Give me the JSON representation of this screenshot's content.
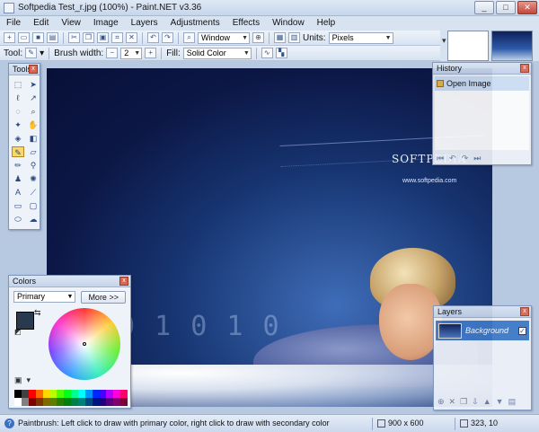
{
  "window": {
    "title": "Softpedia Test_r.jpg (100%) - Paint.NET v3.36",
    "buttons": {
      "minimize": "_",
      "maximize": "□",
      "close": "✕"
    }
  },
  "menu": [
    "File",
    "Edit",
    "View",
    "Image",
    "Layers",
    "Adjustments",
    "Effects",
    "Window",
    "Help"
  ],
  "toolbar": {
    "zoom_mode": "Window",
    "units_label": "Units:",
    "units_value": "Pixels"
  },
  "toolbar2": {
    "tool_label": "Tool:",
    "brush_width_label": "Brush width:",
    "brush_width_value": "2",
    "fill_label": "Fill:",
    "fill_value": "Solid Color"
  },
  "canvas": {
    "watermark": "SOFTPEDIA",
    "watermark_url": "www.softpedia.com"
  },
  "panels": {
    "tools": {
      "title": "Tools"
    },
    "history": {
      "title": "History",
      "items": [
        "Open Image"
      ]
    },
    "colors": {
      "title": "Colors",
      "mode": "Primary",
      "more_button": "More >>"
    },
    "layers": {
      "title": "Layers",
      "items": [
        {
          "name": "Background",
          "visible": true
        }
      ]
    }
  },
  "colors": {
    "primary": "#2a3a4e",
    "secondary": "#ffffff",
    "palette": [
      "#000000",
      "#404040",
      "#ff0000",
      "#ff6a00",
      "#ffd800",
      "#b6ff00",
      "#4cff00",
      "#00ff21",
      "#00ff90",
      "#00ffff",
      "#0094ff",
      "#0026ff",
      "#4800ff",
      "#b200ff",
      "#ff00dc",
      "#ff006e",
      "#ffffff",
      "#808080",
      "#7f0000",
      "#7f3300",
      "#7f6a00",
      "#5b7f00",
      "#267f00",
      "#007f0e",
      "#007f46",
      "#007f7f",
      "#004a7f",
      "#00137f",
      "#21007f",
      "#57007f",
      "#7f006e",
      "#7f0037"
    ]
  },
  "status": {
    "hint": "Paintbrush: Left click to draw with primary color, right click to draw with secondary color",
    "image_size": "900 x 600",
    "cursor_pos": "323, 10"
  }
}
